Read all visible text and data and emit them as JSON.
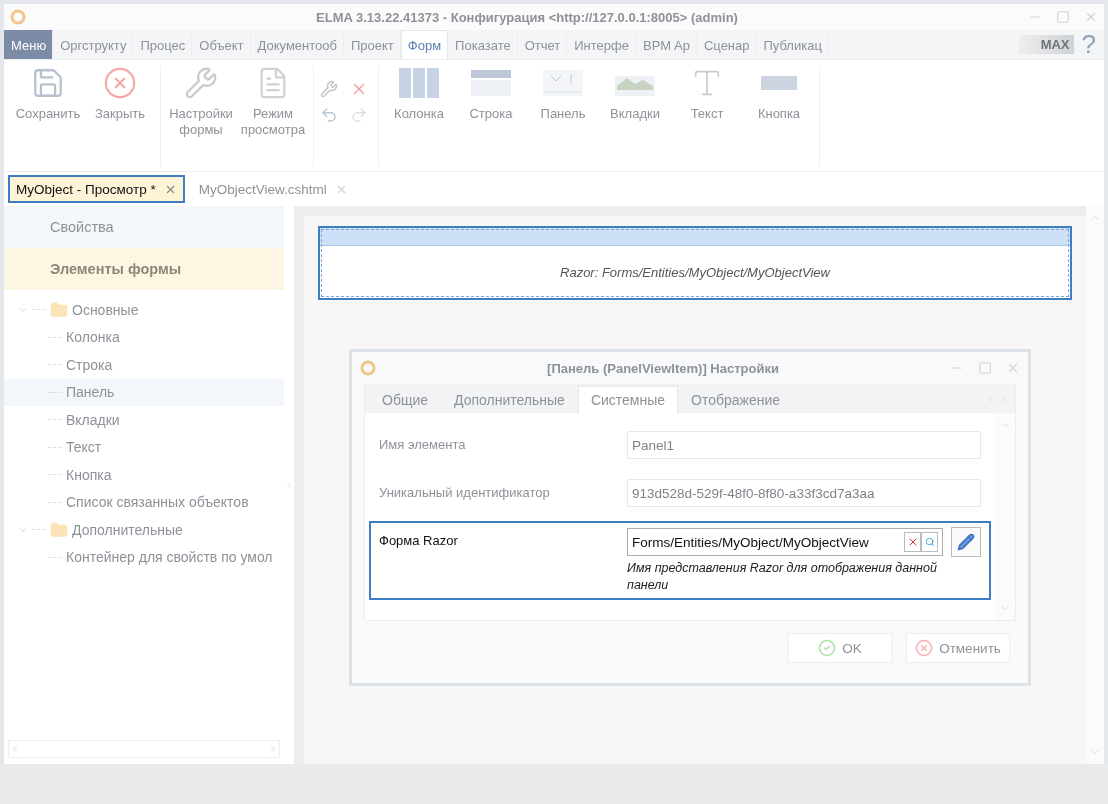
{
  "window": {
    "title": "ELMA 3.13.22.41373 - Конфигурация <http://127.0.0.1:8005> (admin)"
  },
  "ribbon_tabs": [
    {
      "label": "Меню",
      "kind": "menu",
      "selected": false
    },
    {
      "label": "Оргструкту",
      "kind": "tab",
      "selected": false
    },
    {
      "label": "Процес",
      "kind": "tab",
      "selected": false
    },
    {
      "label": "Объект",
      "kind": "tab",
      "selected": false
    },
    {
      "label": "Документооб",
      "kind": "tab",
      "selected": false
    },
    {
      "label": "Проект",
      "kind": "tab",
      "selected": false
    },
    {
      "label": "Форм",
      "kind": "tab",
      "selected": true
    },
    {
      "label": "Показате",
      "kind": "tab",
      "selected": false
    },
    {
      "label": "Отчет",
      "kind": "tab",
      "selected": false
    },
    {
      "label": "Интерфе",
      "kind": "tab",
      "selected": false
    },
    {
      "label": "BPM Ap",
      "kind": "tab",
      "selected": false
    },
    {
      "label": "Сценар",
      "kind": "tab",
      "selected": false
    },
    {
      "label": "Публикац",
      "kind": "tab",
      "selected": false
    }
  ],
  "logo": {
    "text": "MAX"
  },
  "help": {
    "text": "?"
  },
  "toolbar": {
    "groups": [
      {
        "buttons": [
          {
            "label": "Сохранить",
            "kind": "save"
          },
          {
            "label": "Закрыть",
            "kind": "close"
          }
        ]
      },
      {
        "buttons": [
          {
            "label": "Настройки формы",
            "kind": "settings"
          },
          {
            "label": "Режим просмотра",
            "kind": "preview"
          }
        ]
      },
      {
        "buttons": [
          {
            "kind": "wrench"
          },
          {
            "kind": "delete"
          },
          {
            "kind": "undo"
          },
          {
            "kind": "redo"
          }
        ]
      },
      {
        "buttons": [
          {
            "label": "Колонка",
            "kind": "column"
          },
          {
            "label": "Строка",
            "kind": "row"
          },
          {
            "label": "Панель",
            "kind": "panel"
          },
          {
            "label": "Вкладки",
            "kind": "tabs"
          },
          {
            "label": "Текст",
            "kind": "text"
          },
          {
            "label": "Кнопка",
            "kind": "button"
          }
        ]
      }
    ]
  },
  "doc_tabs": [
    {
      "label": "MyObject - Просмотр *",
      "selected": true,
      "highlighted": true
    },
    {
      "label": "MyObjectView.cshtml",
      "selected": false,
      "highlighted": false
    }
  ],
  "sidebar": {
    "sections": [
      {
        "label": "Свойства",
        "selected": false
      },
      {
        "label": "Элементы формы",
        "selected": true
      }
    ],
    "tree": [
      {
        "label": "Основные",
        "expanded": true,
        "children": [
          {
            "label": "Колонка",
            "selected": false
          },
          {
            "label": "Строка",
            "selected": false
          },
          {
            "label": "Панель",
            "selected": true
          },
          {
            "label": "Вкладки",
            "selected": false
          },
          {
            "label": "Текст",
            "selected": false
          },
          {
            "label": "Кнопка",
            "selected": false
          },
          {
            "label": "Список связанных объектов",
            "selected": false
          }
        ]
      },
      {
        "label": "Дополнительные",
        "expanded": true,
        "children": [
          {
            "label": "Контейнер для свойств по умол",
            "selected": false
          }
        ]
      }
    ]
  },
  "canvas": {
    "panel": {
      "caption": "Razor: Forms/Entities/MyObject/MyObjectView",
      "highlighted": true
    }
  },
  "dialog": {
    "title": "[Панель (PanelViewItem)] Настройки",
    "tabs": [
      {
        "label": "Общие",
        "selected": false
      },
      {
        "label": "Дополнительные",
        "selected": false
      },
      {
        "label": "Системные",
        "selected": true
      },
      {
        "label": "Отображение",
        "selected": false
      }
    ],
    "fields": [
      {
        "label": "Имя элемента",
        "value": "Panel1",
        "kind": "text",
        "highlighted": false
      },
      {
        "label": "Уникальный идентификатор",
        "value": "913d528d-529f-48f0-8f80-a33f3cd7a3aa",
        "kind": "text",
        "highlighted": false
      },
      {
        "label": "Форма Razor",
        "value": "Forms/Entities/MyObject/MyObjectView",
        "hint": "Имя представления Razor для отображения данной панели",
        "kind": "lookup",
        "highlighted": true
      }
    ],
    "buttons": [
      {
        "label": "OK",
        "kind": "ok"
      },
      {
        "label": "Отменить",
        "kind": "cancel"
      }
    ]
  }
}
